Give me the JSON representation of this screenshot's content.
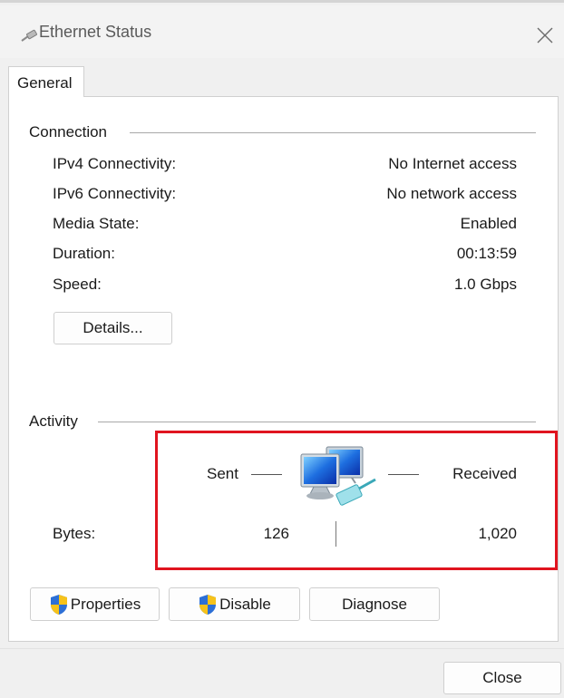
{
  "window": {
    "title": "Ethernet Status",
    "icon": "network-cable-icon",
    "close_icon": "close-icon"
  },
  "tabs": [
    {
      "label": "General",
      "selected": true
    }
  ],
  "connection": {
    "group_label": "Connection",
    "rows": [
      {
        "label": "IPv4 Connectivity:",
        "value": "No Internet access"
      },
      {
        "label": "IPv6 Connectivity:",
        "value": "No network access"
      },
      {
        "label": "Media State:",
        "value": "Enabled"
      },
      {
        "label": "Duration:",
        "value": "00:13:59"
      },
      {
        "label": "Speed:",
        "value": "1.0 Gbps"
      }
    ],
    "details_button": "Details..."
  },
  "activity": {
    "group_label": "Activity",
    "sent_label": "Sent",
    "received_label": "Received",
    "bytes_label": "Bytes:",
    "bytes_sent": "126",
    "bytes_received": "1,020",
    "icon": "network-computers-icon",
    "highlight_color": "#e0141f"
  },
  "actions": {
    "properties_label": "Properties",
    "disable_label": "Disable",
    "diagnose_label": "Diagnose",
    "shield_icon": "uac-shield-icon"
  },
  "footer": {
    "close_label": "Close"
  }
}
